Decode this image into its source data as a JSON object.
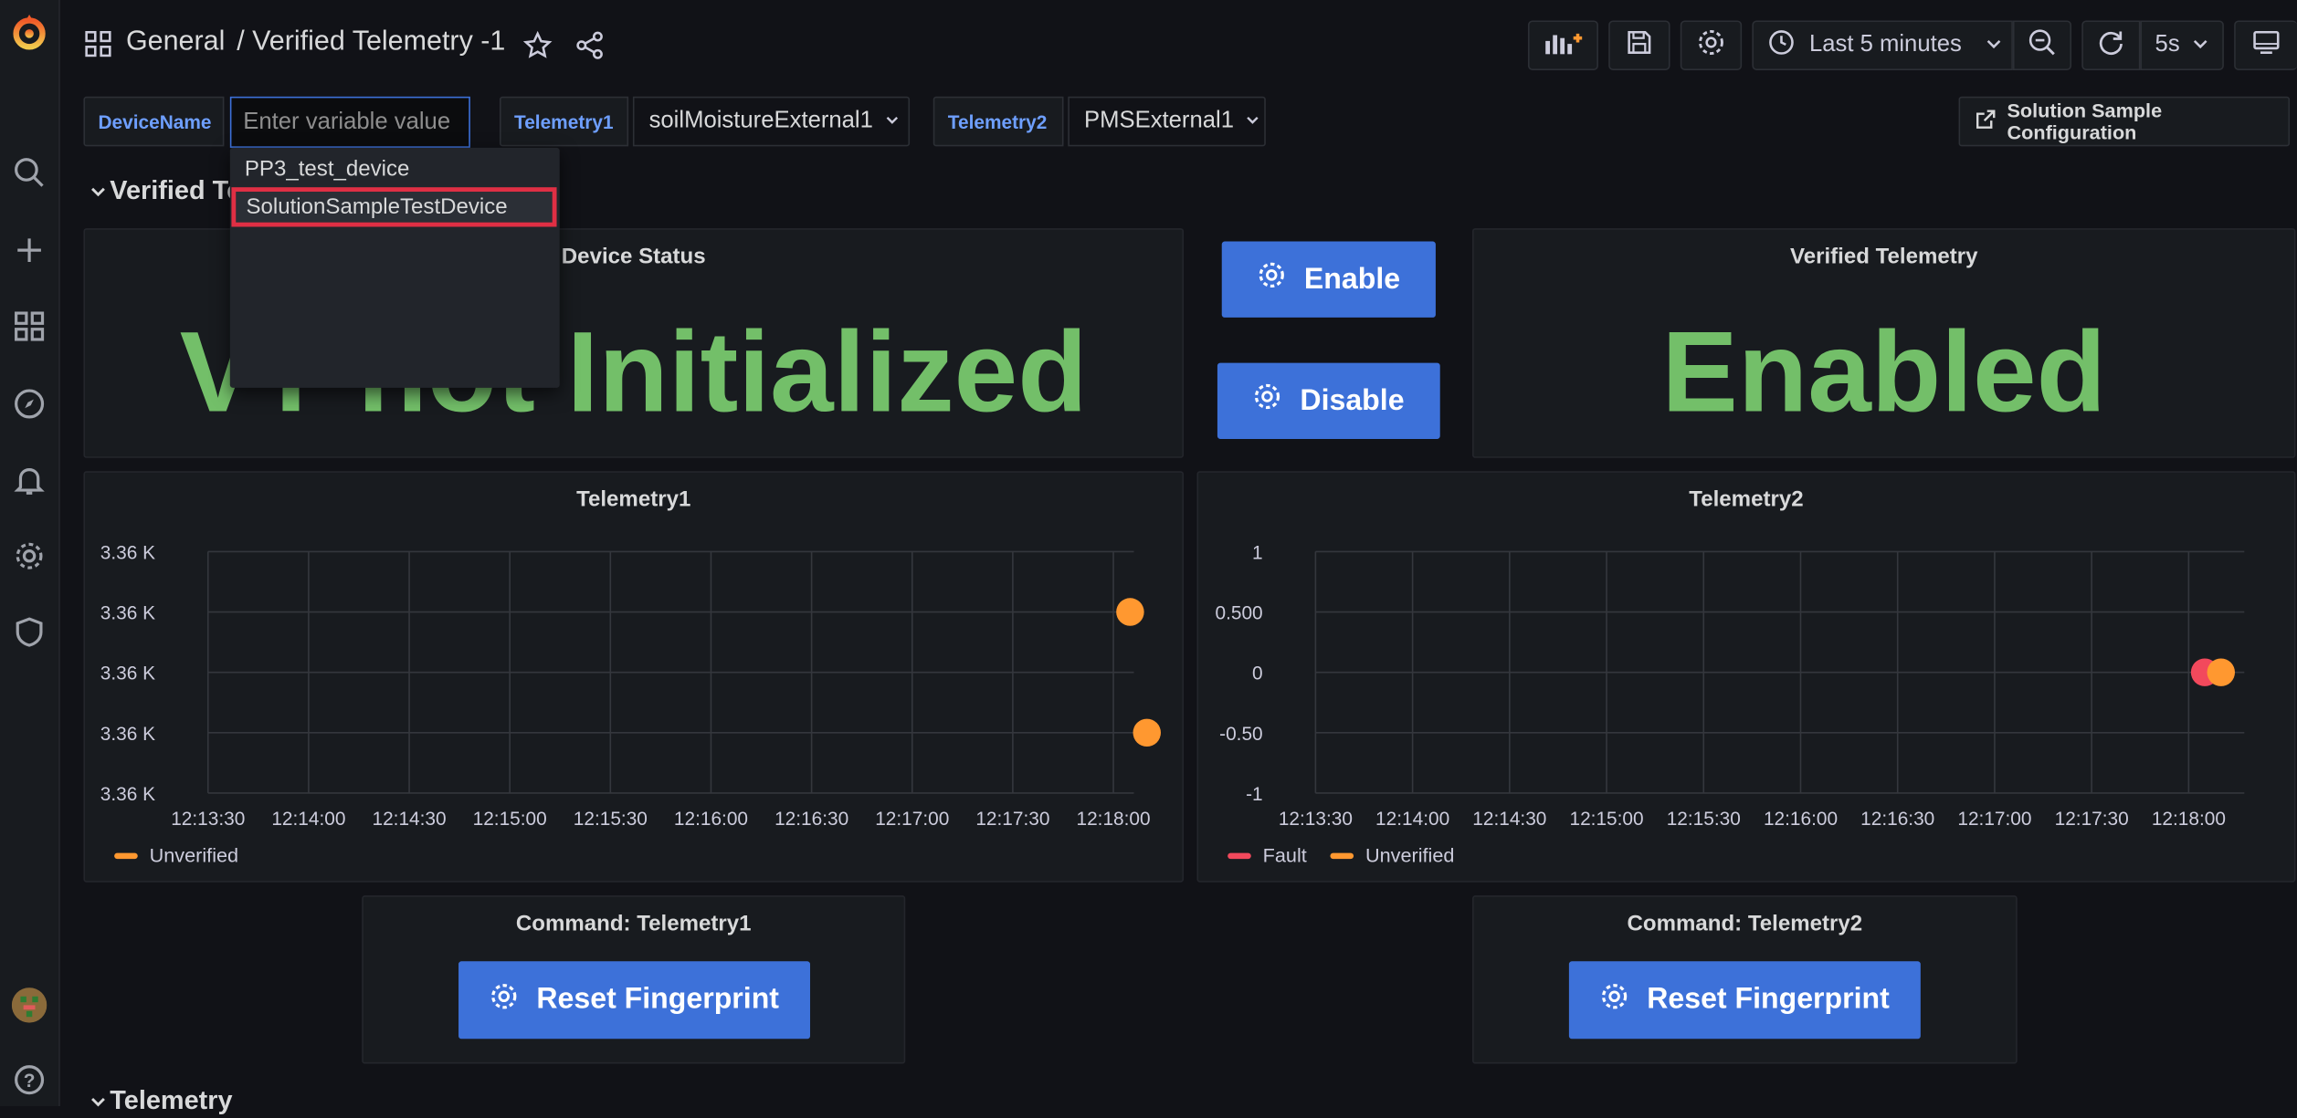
{
  "header": {
    "folder": "General",
    "dashboard_title": "/ Verified Telemetry -1",
    "time_range": "Last 5 minutes",
    "refresh_interval": "5s"
  },
  "variables": {
    "device_name_label": "DeviceName",
    "device_name_placeholder": "Enter variable value",
    "device_options": [
      "PP3_test_device",
      "SolutionSampleTestDevice"
    ],
    "telemetry1_label": "Telemetry1",
    "telemetry1_value": "soilMoistureExternal1",
    "telemetry2_label": "Telemetry2",
    "telemetry2_value": "PMSExternal1",
    "solution_link": "Solution Sample Configuration"
  },
  "rows": {
    "verified_title": "Verified Te",
    "telemetry_title": "Telemetry"
  },
  "panels": {
    "device_status": {
      "title": "Device Status",
      "value": "VT not Initialized"
    },
    "enable_button": "Enable",
    "disable_button": "Disable",
    "verified_telemetry": {
      "title": "Verified Telemetry",
      "value": "Enabled"
    },
    "telemetry1": {
      "title": "Telemetry1"
    },
    "telemetry2": {
      "title": "Telemetry2"
    },
    "command1": {
      "title": "Command: Telemetry1",
      "button": "Reset Fingerprint"
    },
    "command2": {
      "title": "Command: Telemetry2",
      "button": "Reset Fingerprint"
    }
  },
  "colors": {
    "accent_blue": "#3d71d9",
    "stat_green": "#73bf69",
    "series_orange": "#ff9830",
    "series_red": "#f2495c",
    "highlight_red": "#e02f44"
  },
  "chart_data": [
    {
      "type": "scatter",
      "title": "Telemetry1",
      "x_ticks": [
        "12:13:30",
        "12:14:00",
        "12:14:30",
        "12:15:00",
        "12:15:30",
        "12:16:00",
        "12:16:30",
        "12:17:00",
        "12:17:30",
        "12:18:00"
      ],
      "y_ticks": [
        "3.36 K",
        "3.36 K",
        "3.36 K",
        "3.36 K",
        "3.36 K"
      ],
      "series": [
        {
          "name": "Unverified",
          "color": "#ff9830",
          "points": [
            {
              "x": "12:18:05",
              "y_level": 0.75
            },
            {
              "x": "12:18:10",
              "y_level": 0.25
            }
          ]
        }
      ],
      "legend": [
        "Unverified"
      ],
      "legend_position": "bottom-left",
      "grid": true
    },
    {
      "type": "scatter",
      "title": "Telemetry2",
      "x_ticks": [
        "12:13:30",
        "12:14:00",
        "12:14:30",
        "12:15:00",
        "12:15:30",
        "12:16:00",
        "12:16:30",
        "12:17:00",
        "12:17:30",
        "12:18:00"
      ],
      "y_ticks": [
        "1",
        "0.500",
        "0",
        "-0.50",
        "-1"
      ],
      "ylim": [
        -1,
        1
      ],
      "series": [
        {
          "name": "Fault",
          "color": "#f2495c",
          "points": [
            {
              "x": "12:18:05",
              "y": 0
            }
          ]
        },
        {
          "name": "Unverified",
          "color": "#ff9830",
          "points": [
            {
              "x": "12:18:10",
              "y": 0
            }
          ]
        }
      ],
      "legend": [
        "Fault",
        "Unverified"
      ],
      "legend_position": "bottom-left",
      "grid": true
    }
  ]
}
